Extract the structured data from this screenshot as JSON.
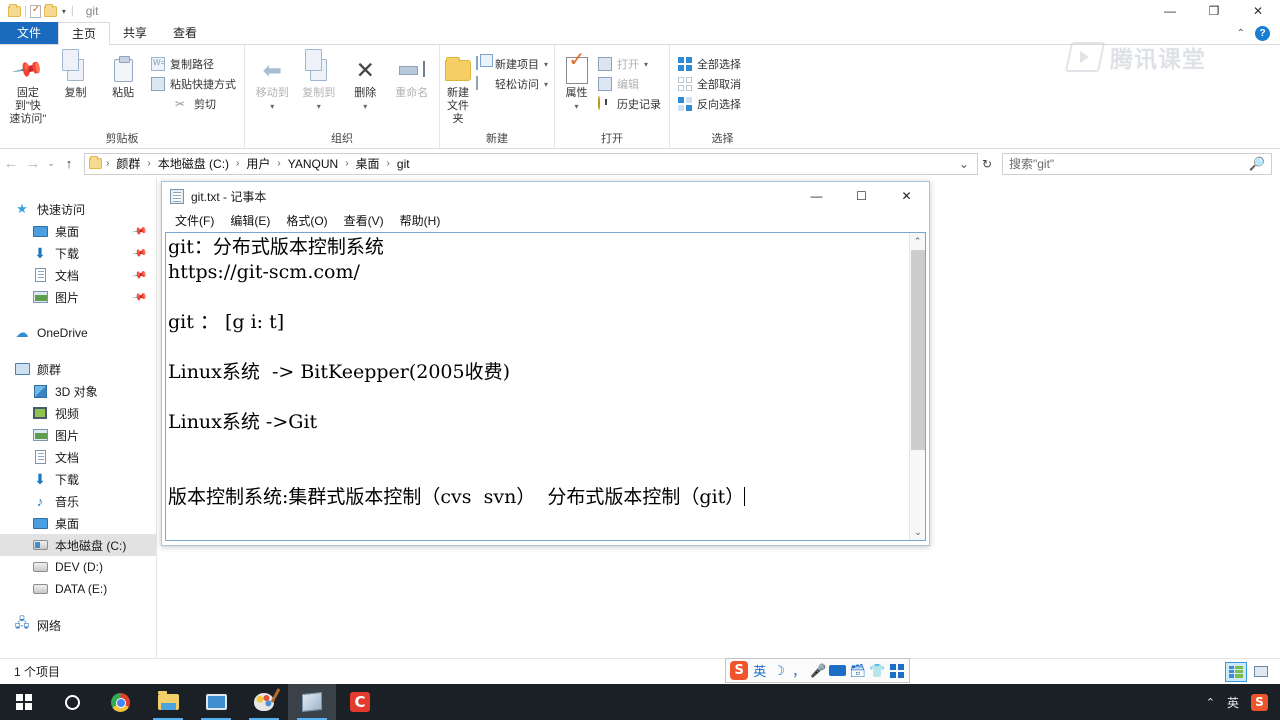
{
  "explorer": {
    "title": "git",
    "quick_access": [
      "folder-icon",
      "properties-icon",
      "new-folder-icon",
      "customize-caret-icon"
    ],
    "window_buttons": {
      "minimize": "—",
      "maximize": "❐",
      "close": "✕"
    },
    "tabs": [
      {
        "label": "文件",
        "type": "file"
      },
      {
        "label": "主页",
        "type": "active"
      },
      {
        "label": "共享",
        "type": "normal"
      },
      {
        "label": "查看",
        "type": "normal"
      }
    ],
    "ribbon_collapse": "⌃",
    "ribbon_help": "?",
    "ribbon_groups": [
      {
        "label": "剪贴板",
        "big": [
          {
            "label1": "固定到\"快",
            "label2": "速访问\"",
            "icon": "pin-icon",
            "disabled": false
          },
          {
            "label1": "复制",
            "label2": "",
            "icon": "copy-icon",
            "disabled": false
          },
          {
            "label1": "粘贴",
            "label2": "",
            "icon": "paste-icon",
            "disabled": false
          }
        ],
        "small": [
          {
            "label": "复制路径",
            "icon": "copy-path-icon",
            "disabled": false
          },
          {
            "label": "粘贴快捷方式",
            "icon": "paste-shortcut-icon",
            "disabled": false
          },
          {
            "label": "剪切",
            "icon": "cut-icon",
            "disabled": false
          }
        ]
      },
      {
        "label": "组织",
        "big": [
          {
            "label1": "移动到",
            "label2": "",
            "icon": "move-to-icon",
            "disabled": true
          },
          {
            "label1": "复制到",
            "label2": "",
            "icon": "copy-to-icon",
            "disabled": true
          },
          {
            "label1": "删除",
            "label2": "",
            "icon": "delete-icon",
            "disabled": false
          },
          {
            "label1": "重命名",
            "label2": "",
            "icon": "rename-icon",
            "disabled": true
          }
        ],
        "small": []
      },
      {
        "label": "新建",
        "big": [
          {
            "label1": "新建",
            "label2": "文件夹",
            "icon": "new-folder-icon",
            "disabled": false
          }
        ],
        "small": [
          {
            "label": "新建项目",
            "icon": "new-item-icon",
            "disabled": false,
            "caret": "▾"
          },
          {
            "label": "轻松访问",
            "icon": "easy-access-icon",
            "disabled": false,
            "caret": "▾"
          }
        ]
      },
      {
        "label": "打开",
        "big": [
          {
            "label1": "属性",
            "label2": "",
            "icon": "properties-icon",
            "disabled": false,
            "caret": "▾"
          }
        ],
        "small": [
          {
            "label": "打开",
            "icon": "open-icon",
            "disabled": true,
            "caret": "▾"
          },
          {
            "label": "编辑",
            "icon": "edit-icon",
            "disabled": true
          },
          {
            "label": "历史记录",
            "icon": "history-icon",
            "disabled": false
          }
        ]
      },
      {
        "label": "选择",
        "big": [],
        "small": [
          {
            "label": "全部选择",
            "icon": "select-all-icon",
            "disabled": false
          },
          {
            "label": "全部取消",
            "icon": "select-none-icon",
            "disabled": false
          },
          {
            "label": "反向选择",
            "icon": "invert-selection-icon",
            "disabled": false
          }
        ]
      }
    ],
    "nav": {
      "back": "←",
      "forward": "→",
      "recent": "⌄",
      "up": "↑",
      "breadcrumbs": [
        "颜群",
        "本地磁盘 (C:)",
        "用户",
        "YANQUN",
        "桌面",
        "git"
      ],
      "dropdown": "⌄",
      "refresh": "↻"
    },
    "search": {
      "placeholder": "搜索\"git\"",
      "icon": "search-icon"
    },
    "sidebar": [
      {
        "label": "快速访问",
        "icon": "star-icon",
        "indent": false,
        "pinned": false,
        "selected": false
      },
      {
        "label": "桌面",
        "icon": "desktop-icon",
        "indent": true,
        "pinned": true,
        "selected": false
      },
      {
        "label": "下载",
        "icon": "download-icon",
        "indent": true,
        "pinned": true,
        "selected": false
      },
      {
        "label": "文档",
        "icon": "documents-icon",
        "indent": true,
        "pinned": true,
        "selected": false
      },
      {
        "label": "图片",
        "icon": "pictures-icon",
        "indent": true,
        "pinned": true,
        "selected": false
      },
      {
        "label": "",
        "icon": "spacer",
        "indent": false,
        "pinned": false,
        "selected": false
      },
      {
        "label": "OneDrive",
        "icon": "cloud-icon",
        "indent": false,
        "pinned": false,
        "selected": false
      },
      {
        "label": "",
        "icon": "spacer",
        "indent": false,
        "pinned": false,
        "selected": false
      },
      {
        "label": "颜群",
        "icon": "this-pc-icon",
        "indent": false,
        "pinned": false,
        "selected": false
      },
      {
        "label": "3D 对象",
        "icon": "3d-objects-icon",
        "indent": true,
        "pinned": false,
        "selected": false
      },
      {
        "label": "视频",
        "icon": "videos-icon",
        "indent": true,
        "pinned": false,
        "selected": false
      },
      {
        "label": "图片",
        "icon": "pictures-icon",
        "indent": true,
        "pinned": false,
        "selected": false
      },
      {
        "label": "文档",
        "icon": "documents-icon",
        "indent": true,
        "pinned": false,
        "selected": false
      },
      {
        "label": "下载",
        "icon": "download-icon",
        "indent": true,
        "pinned": false,
        "selected": false
      },
      {
        "label": "音乐",
        "icon": "music-icon",
        "indent": true,
        "pinned": false,
        "selected": false
      },
      {
        "label": "桌面",
        "icon": "desktop-icon",
        "indent": true,
        "pinned": false,
        "selected": false
      },
      {
        "label": "本地磁盘 (C:)",
        "icon": "system-drive-icon",
        "indent": true,
        "pinned": false,
        "selected": true
      },
      {
        "label": "DEV (D:)",
        "icon": "drive-icon",
        "indent": true,
        "pinned": false,
        "selected": false
      },
      {
        "label": "DATA (E:)",
        "icon": "drive-icon",
        "indent": true,
        "pinned": false,
        "selected": false
      },
      {
        "label": "",
        "icon": "spacer",
        "indent": false,
        "pinned": false,
        "selected": false
      },
      {
        "label": "网络",
        "icon": "network-icon",
        "indent": false,
        "pinned": false,
        "selected": false
      }
    ],
    "status": {
      "text": "1 个项目",
      "view_details": "details-view-icon",
      "view_large": "large-icons-view-icon"
    }
  },
  "notepad": {
    "title": "git.txt - 记事本",
    "icon": "notepad-icon",
    "window_buttons": {
      "minimize": "—",
      "maximize": "☐",
      "close": "✕"
    },
    "menu": [
      "文件(F)",
      "编辑(E)",
      "格式(O)",
      "查看(V)",
      "帮助(H)"
    ],
    "content_lines": [
      "git：分布式版本控制系统",
      "https://git-scm.com/",
      "",
      "git ： [g i: t]",
      "",
      "Linux系统  -> BitKeepper(2005收费)",
      "",
      "Linux系统 ->Git",
      "",
      "",
      "版本控制系统:集群式版本控制（cvs  svn）  分布式版本控制（git）"
    ],
    "scrollbar": {
      "up": "⌃",
      "down": "⌄"
    }
  },
  "ime": {
    "logo": "S",
    "mode": "英",
    "buttons": [
      "moon-icon",
      "comma-icon",
      "microphone-icon",
      "keyboard-icon",
      "toolbox-icon",
      "skin-icon",
      "apps-icon"
    ]
  },
  "watermark": {
    "text": "腾讯课堂",
    "icon": "play-badge-icon"
  },
  "taskbar": {
    "items": [
      {
        "name": "start-button",
        "icon": "windows-icon",
        "active": false,
        "open": false
      },
      {
        "name": "cortana-button",
        "icon": "search-circle-icon",
        "active": false,
        "open": false
      },
      {
        "name": "chrome-button",
        "icon": "chrome-icon",
        "active": false,
        "open": false
      },
      {
        "name": "file-explorer-button",
        "icon": "folder-icon",
        "active": false,
        "open": true
      },
      {
        "name": "remote-desktop-button",
        "icon": "monitor-icon",
        "active": false,
        "open": true
      },
      {
        "name": "paint-button",
        "icon": "paint-icon",
        "active": false,
        "open": true
      },
      {
        "name": "notepad-button",
        "icon": "notepad-icon",
        "active": true,
        "open": true
      },
      {
        "name": "camtasia-button",
        "icon": "camtasia-icon",
        "active": false,
        "open": false
      }
    ],
    "tray": {
      "chevron": "⌃",
      "ime_mode": "英",
      "sogou": "S"
    }
  }
}
